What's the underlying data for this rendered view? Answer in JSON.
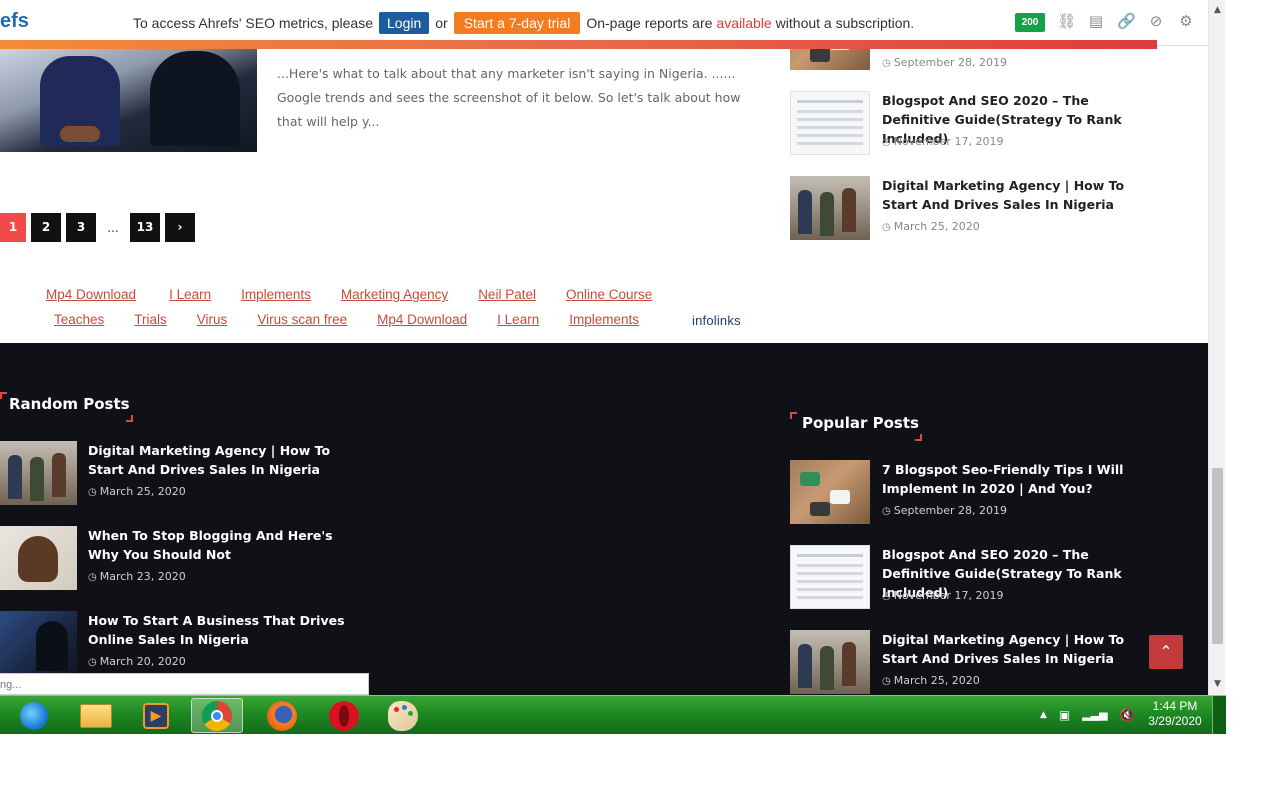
{
  "ahrefs": {
    "logo": "efs",
    "message_prefix": "To access Ahrefs' SEO metrics, please",
    "login_label": "Login",
    "or_label": "or",
    "trial_label": "Start a 7-day trial",
    "message_suffix_1": "On-page reports are",
    "message_available": "available",
    "message_suffix_2": "without a subscription.",
    "badge": "200",
    "icons": [
      "link-broken-icon",
      "bookmark-icon",
      "link-icon",
      "block-icon",
      "gear-icon"
    ]
  },
  "main": {
    "excerpt": "...Here's what to talk about that any marketer isn't saying in Nigeria. ...... Google trends and sees the screenshot of it below. So let's talk about how that will help y..."
  },
  "pagination": {
    "current": "1",
    "pages": [
      "2",
      "3"
    ],
    "ellipsis": "...",
    "last": "13",
    "next_icon": "chevron-right-icon"
  },
  "infolinks": {
    "row1": [
      "Mp4 Download",
      "I Learn",
      "Implements",
      "Marketing Agency",
      "Neil Patel",
      "Online Course"
    ],
    "row2": [
      "Teaches",
      "Trials",
      "Virus",
      "Virus scan free",
      "Mp4 Download",
      "I Learn",
      "Implements"
    ],
    "brand": "infolinks"
  },
  "sidebar_top": [
    {
      "title": "",
      "date": "September 28, 2019"
    },
    {
      "title": "Blogspot And SEO 2020 – The Definitive Guide(Strategy To Rank Included)",
      "date": "November 17, 2019"
    },
    {
      "title": "Digital Marketing Agency | How To Start And Drives Sales In Nigeria",
      "date": "March 25, 2020"
    }
  ],
  "footer": {
    "random_heading": "Random Posts",
    "random_posts": [
      {
        "title": "Digital Marketing Agency | How To Start And Drives Sales In Nigeria",
        "date": "March 25, 2020"
      },
      {
        "title": "When To Stop Blogging And Here's Why You Should Not",
        "date": "March 23, 2020"
      },
      {
        "title": "How To Start A Business That Drives Online Sales In Nigeria",
        "date": "March 20, 2020"
      }
    ],
    "popular_heading": "Popular Posts",
    "popular_posts": [
      {
        "title": "7 Blogspot Seo-Friendly Tips I Will Implement In 2020 | And You?",
        "date": "September 28, 2019"
      },
      {
        "title": "Blogspot And SEO 2020 – The Definitive Guide(Strategy To Rank Included)",
        "date": "November 17, 2019"
      },
      {
        "title": "Digital Marketing Agency | How To Start And Drives Sales In Nigeria",
        "date": "March 25, 2020"
      }
    ],
    "search_placeholder": "ng..."
  },
  "taskbar": {
    "apps": [
      "internet-explorer-icon",
      "file-explorer-icon",
      "media-player-icon",
      "chrome-icon",
      "firefox-icon",
      "opera-icon",
      "paint-icon"
    ],
    "time": "1:44 PM",
    "date": "3/29/2020"
  },
  "colors": {
    "accent_red": "#e04848",
    "footer_bg": "#0f1117",
    "taskbar_green": "#1f8a24",
    "link_red": "#c94c3b"
  }
}
